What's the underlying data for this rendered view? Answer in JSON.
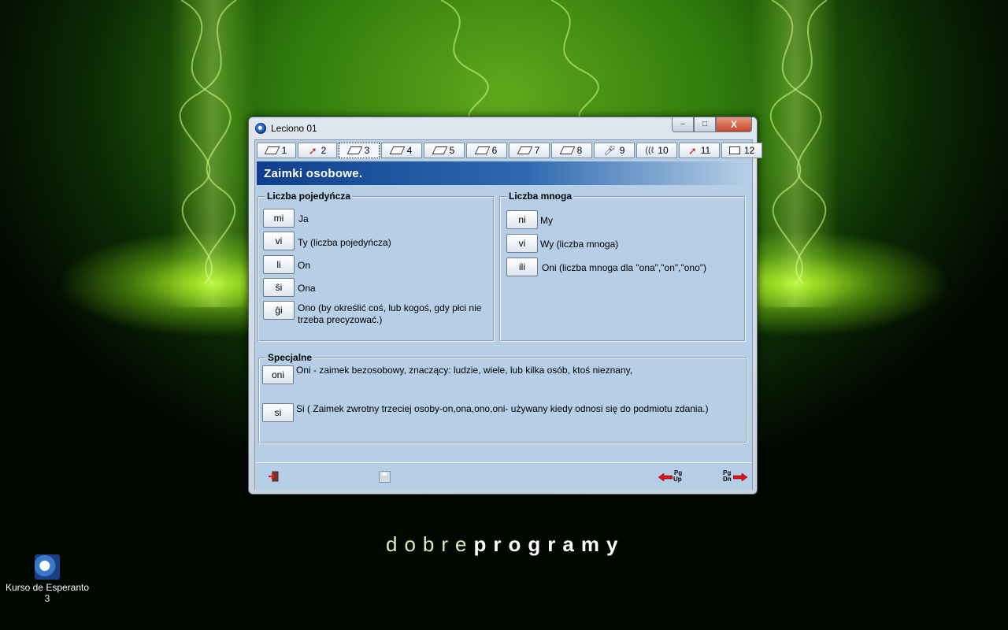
{
  "window": {
    "title": "Leciono 01",
    "buttons": {
      "minimize": "–",
      "maximize": "□",
      "close": "X"
    }
  },
  "tabs": [
    {
      "label": "1",
      "icon": "book-icon"
    },
    {
      "label": "2",
      "icon": "cursor-arrow-icon"
    },
    {
      "label": "3",
      "icon": "book-icon",
      "active": true
    },
    {
      "label": "4",
      "icon": "book-icon"
    },
    {
      "label": "5",
      "icon": "book-icon"
    },
    {
      "label": "6",
      "icon": "book-icon"
    },
    {
      "label": "7",
      "icon": "book-icon"
    },
    {
      "label": "8",
      "icon": "book-icon"
    },
    {
      "label": "9",
      "icon": "microphone-icon"
    },
    {
      "label": "10",
      "icon": "ear-icon"
    },
    {
      "label": "11",
      "icon": "cursor-arrow-icon"
    },
    {
      "label": "12",
      "icon": "card-icon"
    }
  ],
  "header": {
    "title": "Zaimki osobowe."
  },
  "singular": {
    "legend": "Liczba pojedyńcza",
    "items": [
      {
        "button": "mi",
        "text": "Ja"
      },
      {
        "button": "vi",
        "text": "Ty (liczba pojedyńcza)"
      },
      {
        "button": "li",
        "text": "On"
      },
      {
        "button": "ŝi",
        "text": "Ona"
      },
      {
        "button": "ĝi",
        "text": "Ono  (by określić coś, lub kogoś, gdy  płci nie trzeba  precyzować.)"
      }
    ]
  },
  "plural": {
    "legend": "Liczba mnoga",
    "items": [
      {
        "button": "ni",
        "text": "My"
      },
      {
        "button": "vi",
        "text": "Wy  (liczba  mnoga)"
      },
      {
        "button": "ili",
        "text": "Oni  (liczba mnoga dla \"ona\",\"on\",\"ono\")"
      }
    ]
  },
  "special": {
    "legend": "Specjalne",
    "items": [
      {
        "button": "oni",
        "text": "Oni -   zaimek  bezosobowy, znaczący:  ludzie, wiele,  lub kilka osób, ktoś nieznany,"
      },
      {
        "button": "si",
        "text": "Si ( Zaimek zwrotny trzeciej osoby-on,ona,ono,oni- używany kiedy odnosi się do podmiotu  zdania.)"
      }
    ]
  },
  "bottom": {
    "pgup": {
      "top": "Pg",
      "bottom": "Up"
    },
    "pgdn": {
      "top": "Pg",
      "bottom": "Dn"
    }
  },
  "desktop": {
    "icon_label": "Kurso de Esperanto 3",
    "brand_light": "dobre",
    "brand_bold": "programy"
  }
}
